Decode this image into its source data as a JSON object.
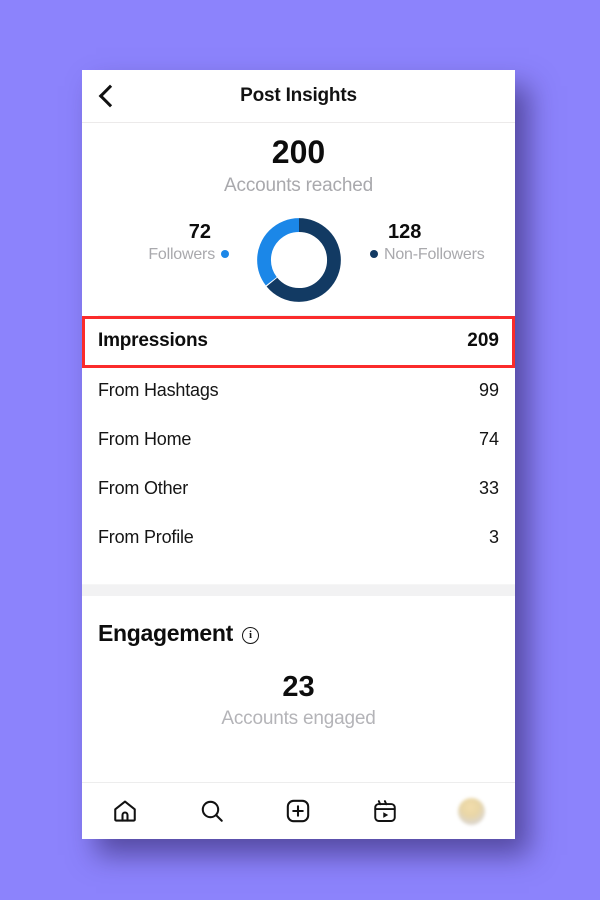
{
  "theme": {
    "background_color": "#8c83fc",
    "card_color": "#ffffff",
    "highlight_color": "#fb2b2b",
    "followers_color": "#1b87e8",
    "nonfollowers_color": "#123a63"
  },
  "header": {
    "title": "Post Insights",
    "back_icon": "chevron-left-icon"
  },
  "reach": {
    "value": "200",
    "label": "Accounts reached"
  },
  "chart_data": {
    "type": "pie",
    "title": "Accounts reached",
    "categories": [
      "Followers",
      "Non-Followers"
    ],
    "values": [
      72,
      128
    ],
    "total": 200,
    "colors": [
      "#1b87e8",
      "#123a63"
    ],
    "legend": "sides",
    "donut": true,
    "labels": [
      {
        "name": "Followers",
        "value": "72",
        "color": "#1b87e8",
        "side": "left"
      },
      {
        "name": "Non-Followers",
        "value": "128",
        "color": "#123a63",
        "side": "right"
      }
    ]
  },
  "impressions": {
    "title": "Impressions",
    "total": "209",
    "highlighted": true,
    "rows": [
      {
        "label": "From Hashtags",
        "value": "99"
      },
      {
        "label": "From Home",
        "value": "74"
      },
      {
        "label": "From Other",
        "value": "33"
      },
      {
        "label": "From Profile",
        "value": "3"
      }
    ]
  },
  "engagement": {
    "title": "Engagement",
    "info_icon": "info-circle-icon",
    "value": "23",
    "label": "Accounts engaged"
  },
  "bottom_nav": {
    "items": [
      {
        "name": "home-icon"
      },
      {
        "name": "search-icon"
      },
      {
        "name": "add-post-icon"
      },
      {
        "name": "reels-icon"
      },
      {
        "name": "profile-avatar"
      }
    ]
  }
}
